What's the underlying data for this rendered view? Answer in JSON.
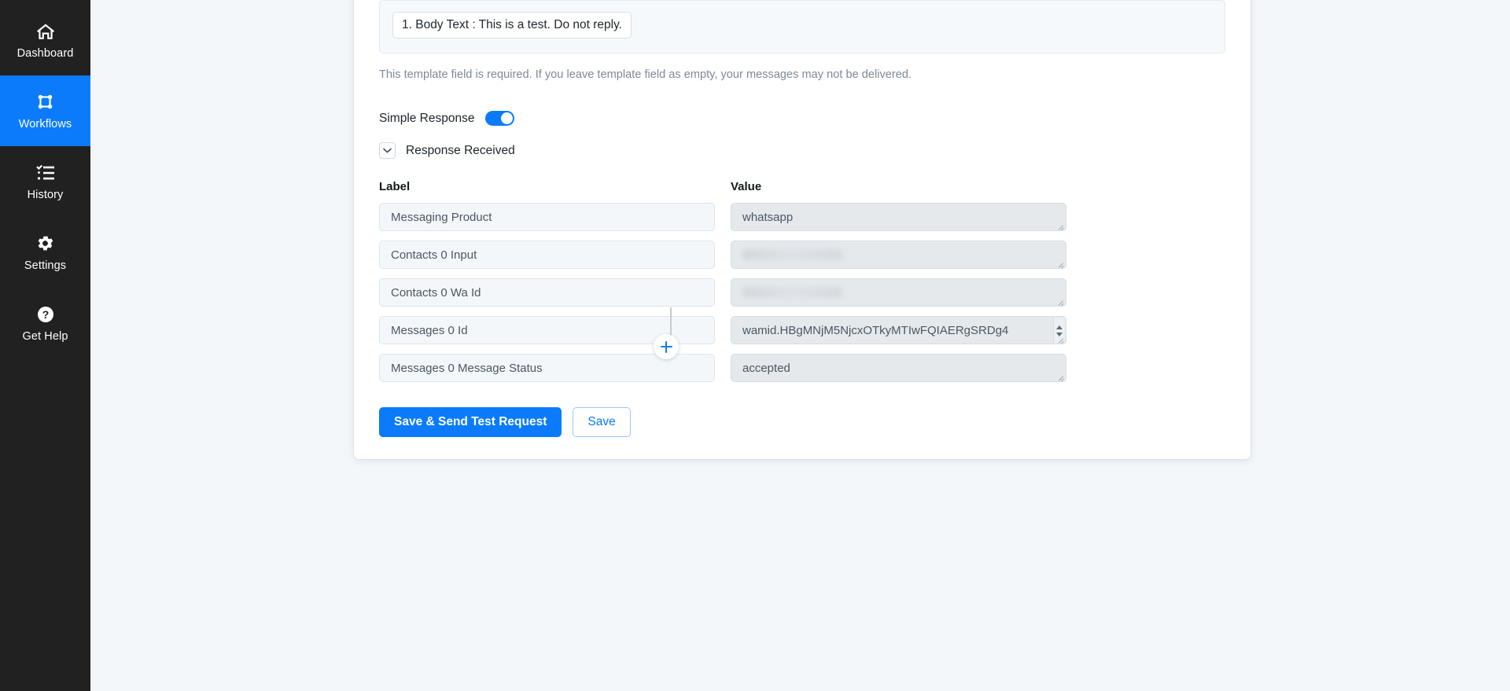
{
  "sidebar": {
    "items": [
      {
        "label": "Dashboard",
        "icon": "home-icon",
        "active": false
      },
      {
        "label": "Workflows",
        "icon": "workflow-icon",
        "active": true
      },
      {
        "label": "History",
        "icon": "history-list-icon",
        "active": false
      },
      {
        "label": "Settings",
        "icon": "gear-icon",
        "active": false
      },
      {
        "label": "Get Help",
        "icon": "question-circle-icon",
        "active": false
      }
    ],
    "active_color": "#0b7bfb",
    "background_color": "#212121"
  },
  "node": {
    "template_preview": {
      "chip_text": "1. Body Text : This is a test. Do not reply."
    },
    "help_text": "This template field is required. If you leave template field as empty, your messages may not be delivered.",
    "simple_response": {
      "label": "Simple Response",
      "enabled": true,
      "toggle_color": "#0b7bfb"
    },
    "accordion": {
      "title": "Response Received",
      "chevron_icon": "chevron-down-icon",
      "expanded": true
    },
    "table": {
      "headers": {
        "label": "Label",
        "value": "Value"
      },
      "rows": [
        {
          "label": "Messaging Product",
          "value": "whatsapp",
          "redacted": false,
          "spinner": false
        },
        {
          "label": "Contacts 0 Input",
          "value": "",
          "redacted": true,
          "spinner": false
        },
        {
          "label": "Contacts 0 Wa Id",
          "value": "",
          "redacted": true,
          "spinner": false
        },
        {
          "label": "Messages 0 Id",
          "value": "wamid.HBgMNjM5NjcxOTkyMTIwFQIAERgSRDg4",
          "redacted": false,
          "spinner": true
        },
        {
          "label": "Messages 0 Message Status",
          "value": "accepted",
          "redacted": false,
          "spinner": false
        }
      ]
    },
    "buttons": {
      "primary": "Save & Send Test Request",
      "secondary": "Save"
    }
  },
  "canvas": {
    "add_node_icon": "plus-icon",
    "add_node_color": "#1478f0"
  }
}
